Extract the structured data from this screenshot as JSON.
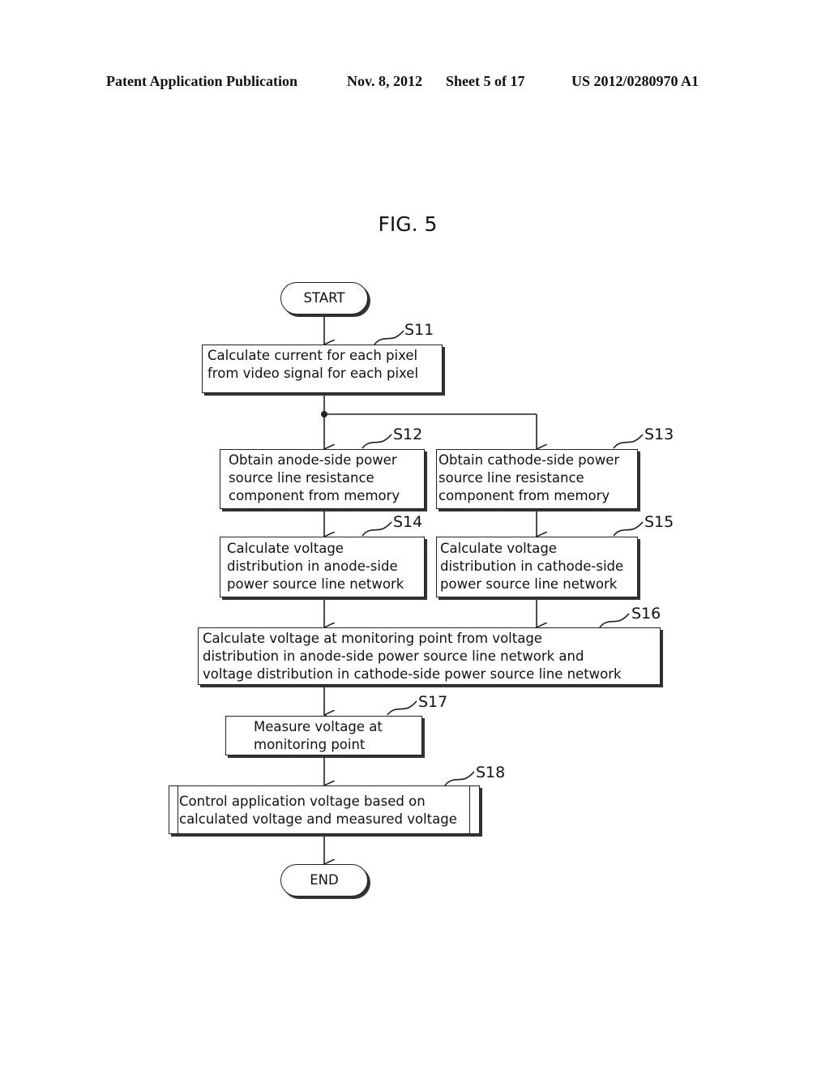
{
  "header": {
    "publication": "Patent Application Publication",
    "date": "Nov. 8, 2012",
    "sheet": "Sheet 5 of 17",
    "number": "US 2012/0280970 A1"
  },
  "figure": {
    "title": "FIG. 5"
  },
  "flowchart": {
    "start": "START",
    "end": "END",
    "steps": {
      "s11": {
        "label": "S11",
        "lines": [
          "Calculate current for each pixel",
          "from video signal for each pixel"
        ]
      },
      "s12": {
        "label": "S12",
        "lines": [
          "Obtain anode-side power",
          "source line resistance",
          "component from memory"
        ]
      },
      "s13": {
        "label": "S13",
        "lines": [
          "Obtain cathode-side power",
          "source line resistance",
          "component from memory"
        ]
      },
      "s14": {
        "label": "S14",
        "lines": [
          "Calculate voltage",
          "distribution in anode-side",
          "power source line network"
        ]
      },
      "s15": {
        "label": "S15",
        "lines": [
          "Calculate voltage",
          "distribution in cathode-side",
          "power source line network"
        ]
      },
      "s16": {
        "label": "S16",
        "lines": [
          "Calculate voltage at monitoring point from voltage",
          "distribution in anode-side power source line network and",
          "voltage distribution in cathode-side power source line network"
        ]
      },
      "s17": {
        "label": "S17",
        "lines": [
          "Measure voltage at",
          "monitoring point"
        ]
      },
      "s18": {
        "label": "S18",
        "lines": [
          "Control application voltage based on",
          "calculated voltage and measured voltage"
        ]
      }
    }
  }
}
